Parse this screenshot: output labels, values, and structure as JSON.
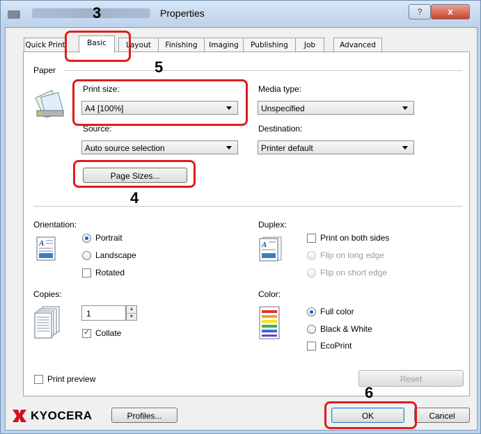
{
  "window": {
    "title": "Properties",
    "help_label": "?",
    "close_label": "x"
  },
  "tabs": [
    {
      "label": "Quick Print"
    },
    {
      "label": "Basic"
    },
    {
      "label": "Layout"
    },
    {
      "label": "Finishing"
    },
    {
      "label": "Imaging"
    },
    {
      "label": "Publishing"
    },
    {
      "label": "Job"
    },
    {
      "label": "Advanced"
    }
  ],
  "paper": {
    "section_label": "Paper",
    "print_size_label": "Print size:",
    "print_size_value": "A4  [100%]",
    "media_type_label": "Media type:",
    "media_type_value": "Unspecified",
    "source_label": "Source:",
    "source_value": "Auto source selection",
    "destination_label": "Destination:",
    "destination_value": "Printer default",
    "page_sizes_button": "Page Sizes..."
  },
  "orientation": {
    "label": "Orientation:",
    "portrait": "Portrait",
    "landscape": "Landscape",
    "rotated": "Rotated",
    "selected": "portrait"
  },
  "duplex": {
    "label": "Duplex:",
    "print_both": "Print on both sides",
    "flip_long": "Flip on long edge",
    "flip_short": "Flip on short edge"
  },
  "copies": {
    "label": "Copies:",
    "value": "1",
    "collate": "Collate",
    "collate_checked": true
  },
  "color": {
    "label": "Color:",
    "full": "Full color",
    "bw": "Black & White",
    "ecoprint": "EcoPrint",
    "selected": "full"
  },
  "footer": {
    "print_preview": "Print preview",
    "reset": "Reset",
    "brand": "KYOCERA",
    "profiles": "Profiles...",
    "ok": "OK",
    "cancel": "Cancel"
  },
  "annotations": {
    "n3": "3",
    "n4": "4",
    "n5": "5",
    "n6": "6"
  },
  "colors": {
    "highlight": "#e01c1c",
    "radio_selected": "#1f5fc9",
    "brand": "#d0121b"
  }
}
